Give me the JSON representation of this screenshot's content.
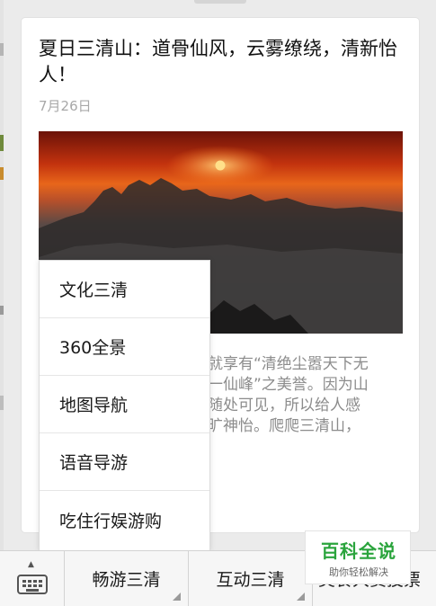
{
  "article": {
    "title": "夏日三清山：道骨仙风，云雾缭绕，清新怡人！",
    "date": "7月26日",
    "body_lines": [
      "古就享有“清绝尘嚣天下无",
      "第一仙峰”之美誉。因为山",
      "石随处可见，所以给人感",
      "心旷神怡。爬爬三清山，",
      "!"
    ]
  },
  "popup_menu": {
    "items": [
      "文化三清",
      "360全景",
      "地图导航",
      "语音导游",
      "吃住行娱游购"
    ]
  },
  "bottom_bar": {
    "items": [
      "畅游三清",
      "互动三清",
      "美食大赛投票"
    ]
  },
  "watermark": {
    "brand": "百科全说",
    "tagline": "助你轻松解决"
  },
  "colors": {
    "brand_green": "#2aa43c",
    "date_gray": "#a8a8a8",
    "sun": "#ffe08a"
  },
  "icons": {
    "keyboard": "keyboard-icon",
    "caret": "caret-up-icon"
  }
}
